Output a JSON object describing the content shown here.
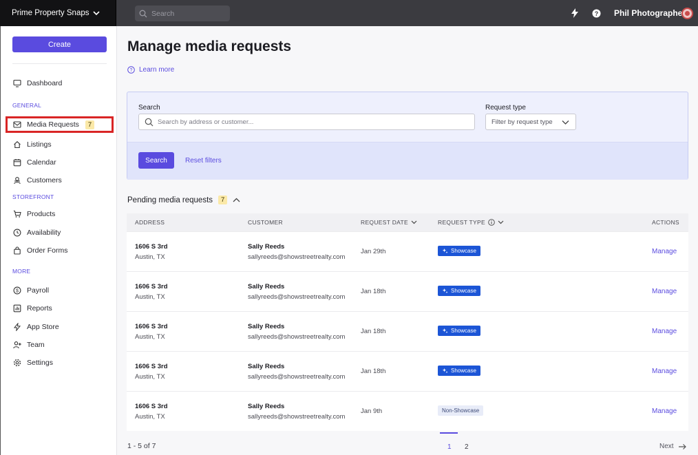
{
  "brand": {
    "name": "Prime Property Snaps"
  },
  "topbar": {
    "search_placeholder": "Search",
    "user_name": "Phil Photographer"
  },
  "sidebar": {
    "create_label": "Create",
    "dashboard": "Dashboard",
    "section_general": "GENERAL",
    "media_requests": "Media Requests",
    "media_requests_count": "7",
    "listings": "Listings",
    "calendar": "Calendar",
    "customers": "Customers",
    "section_storefront": "STOREFRONT",
    "products": "Products",
    "availability": "Availability",
    "order_forms": "Order Forms",
    "section_more": "MORE",
    "payroll": "Payroll",
    "reports": "Reports",
    "app_store": "App Store",
    "team": "Team",
    "settings": "Settings"
  },
  "main": {
    "title": "Manage media requests",
    "learn_more": "Learn more",
    "filters": {
      "search_label": "Search",
      "search_placeholder": "Search by address or customer...",
      "type_label": "Request type",
      "type_placeholder": "Filter by request type",
      "search_button": "Search",
      "reset_button": "Reset filters"
    },
    "pending": {
      "title": "Pending media requests",
      "count": "7"
    },
    "table": {
      "columns": {
        "address": "ADDRESS",
        "customer": "CUSTOMER",
        "request_date": "REQUEST DATE",
        "request_type": "REQUEST TYPE",
        "actions": "ACTIONS"
      },
      "rows": [
        {
          "address_line1": "1606 S 3rd",
          "address_line2": "Austin, TX",
          "customer_name": "Sally Reeds",
          "customer_email": "sallyreeds@showstreetrealty.com",
          "date": "Jan 29th",
          "type": "Showcase",
          "action": "Manage"
        },
        {
          "address_line1": "1606 S 3rd",
          "address_line2": "Austin, TX",
          "customer_name": "Sally Reeds",
          "customer_email": "sallyreeds@showstreetrealty.com",
          "date": "Jan 18th",
          "type": "Showcase",
          "action": "Manage"
        },
        {
          "address_line1": "1606 S 3rd",
          "address_line2": "Austin, TX",
          "customer_name": "Sally Reeds",
          "customer_email": "sallyreeds@showstreetrealty.com",
          "date": "Jan 18th",
          "type": "Showcase",
          "action": "Manage"
        },
        {
          "address_line1": "1606 S 3rd",
          "address_line2": "Austin, TX",
          "customer_name": "Sally Reeds",
          "customer_email": "sallyreeds@showstreetrealty.com",
          "date": "Jan 18th",
          "type": "Showcase",
          "action": "Manage"
        },
        {
          "address_line1": "1606 S 3rd",
          "address_line2": "Austin, TX",
          "customer_name": "Sally Reeds",
          "customer_email": "sallyreeds@showstreetrealty.com",
          "date": "Jan 9th",
          "type": "Non-Showcase",
          "action": "Manage"
        }
      ]
    },
    "pagination": {
      "range": "1 - 5 of 7",
      "page1": "1",
      "page2": "2",
      "next": "Next"
    }
  },
  "colors": {
    "accent": "#5a4bdf",
    "showcase_tag": "#1c55d6",
    "highlight": "#d92525",
    "badge": "#fbe9a8"
  }
}
